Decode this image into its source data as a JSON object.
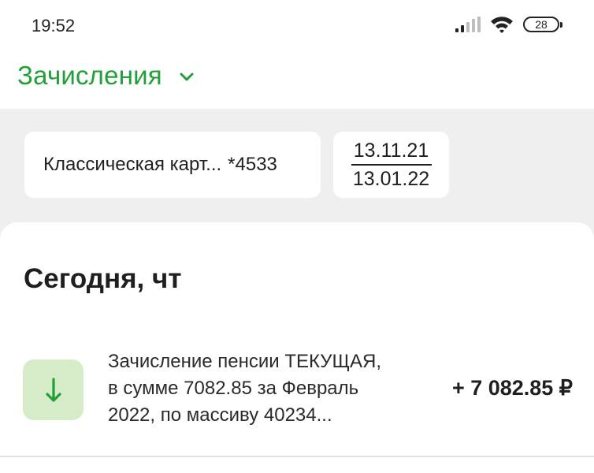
{
  "status_bar": {
    "time": "19:52",
    "battery": "28",
    "icons": [
      "signal-icon",
      "wifi-icon",
      "battery-icon"
    ]
  },
  "header": {
    "title": "Зачисления",
    "dropdown_icon": "chevron-down-icon"
  },
  "filters": {
    "card_name": "Классическая карт...",
    "card_number": "*4533",
    "date_from": "13.11.21",
    "date_to": "13.01.22"
  },
  "section": {
    "title": "Сегодня, чт"
  },
  "transactions": [
    {
      "icon": "arrow-down-icon",
      "line1": "Зачисление пенсии ТЕКУЩАЯ,",
      "line2": "в сумме 7082.85 за Февраль",
      "line3": "2022, по массиву 40234...",
      "amount": "+ 7 082.85 ₽"
    }
  ],
  "colors": {
    "accent": "#21a038",
    "icon_bg": "#d6ebc7",
    "page_bg": "#efefef"
  }
}
